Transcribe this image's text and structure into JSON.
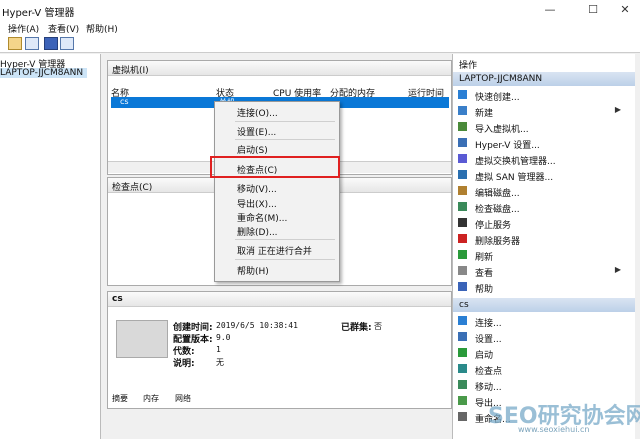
{
  "window": {
    "title": "Hyper-V 管理器",
    "min": "—",
    "max": "☐",
    "close": "✕"
  },
  "menu": {
    "items": [
      "操作(A)",
      "查看(V)",
      "帮助(H)"
    ]
  },
  "tree": {
    "root": "Hyper-V 管理器",
    "host": "LAPTOP-JJCM8ANN"
  },
  "vm_panel": {
    "title": "虚拟机(I)",
    "columns": [
      "名称",
      "状态",
      "CPU 使用率",
      "分配的内存",
      "运行时间"
    ],
    "row": {
      "name": "cs",
      "state": "关机"
    }
  },
  "checkpoint_panel": {
    "title": "检查点(C)"
  },
  "context_menu": {
    "items": [
      "连接(O)...",
      "设置(E)...",
      "启动(S)",
      "检查点(C)",
      "移动(V)...",
      "导出(X)...",
      "重命名(M)...",
      "删除(D)...",
      "取消 正在进行合并",
      "帮助(H)"
    ]
  },
  "details": {
    "title": "cs",
    "created_label": "创建时间:",
    "created_value": "2019/6/5 10:38:41",
    "config_label": "配置版本:",
    "config_value": "9.0",
    "gen_label": "代数:",
    "gen_value": "1",
    "note_label": "说明:",
    "note_value": "无",
    "cluster_label": "已群集:",
    "cluster_value": "否",
    "tabs": [
      "摘要",
      "内存",
      "网络"
    ]
  },
  "actions": {
    "title": "操作",
    "host_group": "LAPTOP-JJCM8ANN",
    "host_items": [
      "快速创建...",
      "新建",
      "导入虚拟机...",
      "Hyper-V 设置...",
      "虚拟交换机管理器...",
      "虚拟 SAN 管理器...",
      "编辑磁盘...",
      "检查磁盘...",
      "停止服务",
      "删除服务器",
      "刷新",
      "查看",
      "帮助"
    ],
    "vm_group": "cs",
    "vm_items": [
      "连接...",
      "设置...",
      "启动",
      "检查点",
      "移动...",
      "导出...",
      "重命名..."
    ]
  },
  "watermark": {
    "big": "SEO研究协会网",
    "small": "www.seoxiehui.cn"
  },
  "colors": {
    "highlight": "#e02020",
    "group_bg": "#c8d8ee",
    "selected_row": "#0a78d7"
  }
}
